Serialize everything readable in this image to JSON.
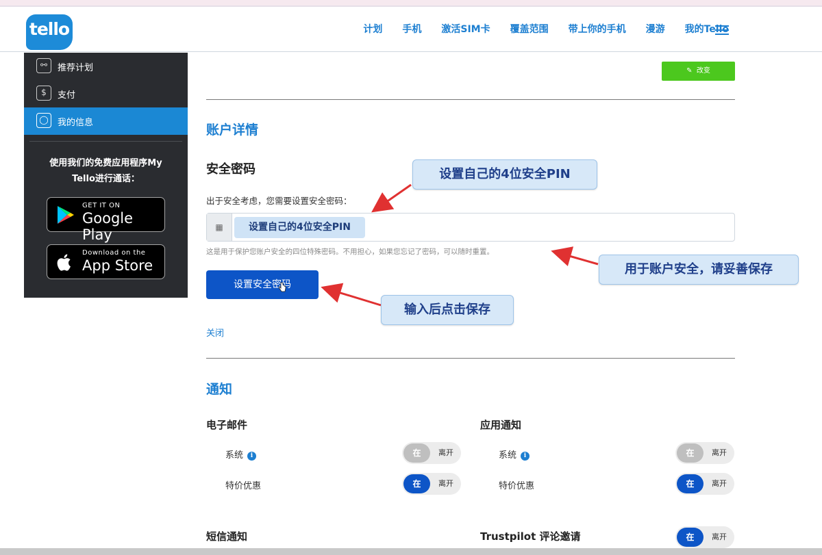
{
  "header": {
    "logo": "tello",
    "nav": [
      "计划",
      "手机",
      "激活SIM卡",
      "覆盖范围",
      "带上你的手机",
      "漫游",
      "我的Tello"
    ]
  },
  "sidebar": {
    "items": [
      {
        "label": "推荐计划",
        "icon": "share-icon",
        "glyph": "⚯"
      },
      {
        "label": "支付",
        "icon": "dollar-icon",
        "glyph": "$"
      },
      {
        "label": "我的信息",
        "icon": "user-icon",
        "glyph": "◯"
      }
    ],
    "promo_line1": "使用我们的免费应用程序My",
    "promo_line2": "Tello进行通话：",
    "google_small": "GET IT ON",
    "google_big": "Google Play",
    "apple_small": "Download on the",
    "apple_big": "App Store"
  },
  "main": {
    "edit_label": "改变",
    "account_title": "账户详情",
    "security_title": "安全密码",
    "security_desc": "出于安全考虑，您需要设置安全密码：",
    "pin_value": "设置自己的4位安全PIN",
    "pin_hint": "这是用于保护您账户安全的四位特殊密码。不用担心，如果您忘记了密码，可以随时重置。",
    "set_button": "设置安全密码",
    "close_link": "关闭",
    "notify_title": "通知"
  },
  "callouts": {
    "pin": "设置自己的4位安全PIN",
    "safety": "用于账户安全，请妥善保存",
    "save": "输入后点击保存"
  },
  "notifications": {
    "email": {
      "title": "电子邮件",
      "rows": [
        {
          "label": "系统",
          "info": true,
          "on": "在",
          "off": "离开",
          "state": "inactive"
        },
        {
          "label": "特价优惠",
          "info": false,
          "on": "在",
          "off": "离开",
          "state": "active"
        }
      ]
    },
    "app": {
      "title": "应用通知",
      "rows": [
        {
          "label": "系统",
          "info": true,
          "on": "在",
          "off": "离开",
          "state": "inactive"
        },
        {
          "label": "特价优惠",
          "info": false,
          "on": "在",
          "off": "离开",
          "state": "active"
        }
      ]
    },
    "sms": {
      "title": "短信通知"
    },
    "trustpilot": {
      "title": "Trustpilot 评论邀请",
      "on": "在",
      "off": "离开",
      "state": "active"
    }
  },
  "colors": {
    "brand": "#1d7fd1",
    "primary": "#0d55c7",
    "green": "#4cc81e",
    "sidebar": "#2a2c30",
    "callout_bg": "#d7e8f8",
    "arrow": "#e03131"
  }
}
